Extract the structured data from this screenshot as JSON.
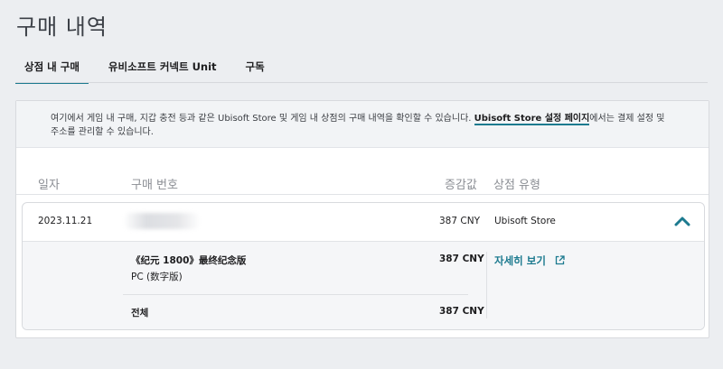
{
  "page": {
    "title": "구매 내역"
  },
  "tabs": [
    {
      "label": "상점 내 구매",
      "active": true
    },
    {
      "label": "유비소프트 커넥트 Unit",
      "active": false
    },
    {
      "label": "구독",
      "active": false
    }
  ],
  "notice": {
    "text_before": "여기에서 게임 내 구매, 지갑 충전 등과 같은 Ubisoft Store 및 게임 내 상점의 구매 내역을 확인할 수 있습니다. ",
    "link_label": "Ubisoft Store 설정 페이지",
    "text_after": "에서는 결제 설정 및 주소를 관리할 수 있습니다."
  },
  "table": {
    "headers": {
      "date": "일자",
      "order_number": "구매 번호",
      "amount": "증감값",
      "store_type": "상점 유형"
    }
  },
  "order": {
    "date": "2023.11.21",
    "amount": "387 CNY",
    "store_type": "Ubisoft Store",
    "item": {
      "name": "《纪元 1800》最终纪念版",
      "platform": "PC (数字版)",
      "amount": "387 CNY"
    },
    "total_label": "전체",
    "total_amount": "387 CNY",
    "details_link": "자세히 보기",
    "expanded": true
  },
  "colors": {
    "accent": "#1c7a8f",
    "background": "#eceef1"
  },
  "icons": {
    "collapse": "chevron-up-icon",
    "external": "external-link-icon"
  }
}
